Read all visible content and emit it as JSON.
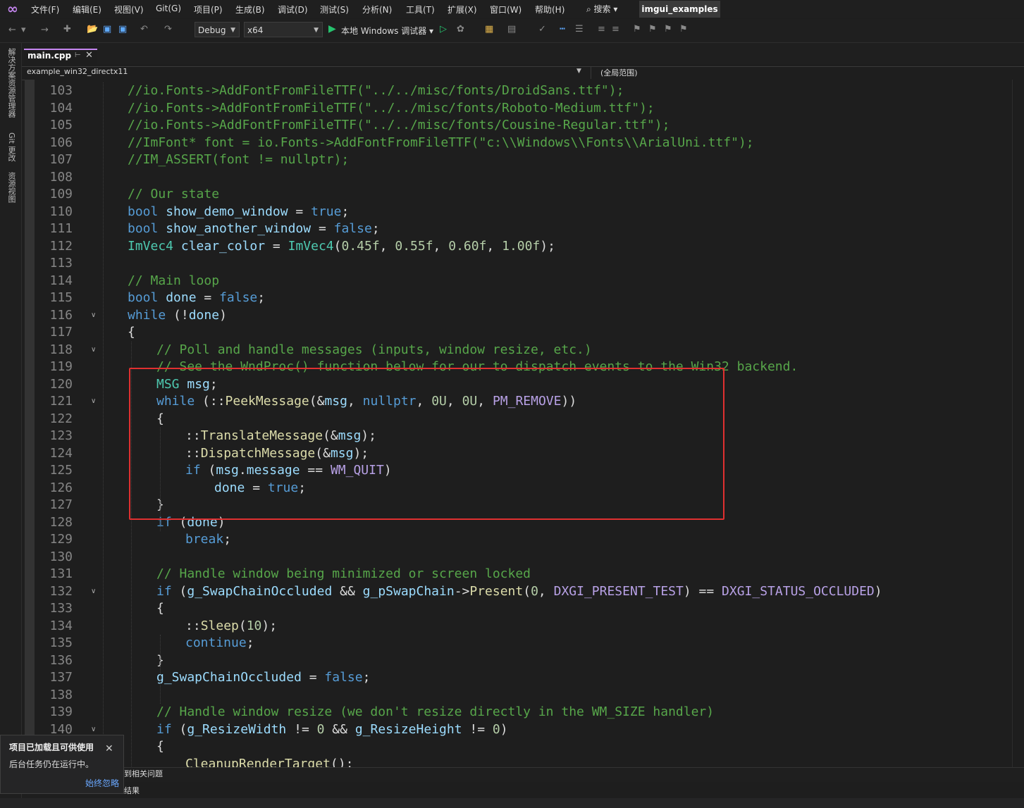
{
  "menu": {
    "items": [
      "文件(F)",
      "编辑(E)",
      "视图(V)",
      "Git(G)",
      "项目(P)",
      "生成(B)",
      "调试(D)",
      "测试(S)",
      "分析(N)",
      "工具(T)",
      "扩展(X)",
      "窗口(W)",
      "帮助(H)"
    ],
    "search": "⌕ 搜索 ▾",
    "solution_title": "imgui_examples"
  },
  "toolbar": {
    "config": "Debug",
    "platform": "x64",
    "run_label": "本地 Windows 调试器 ▾"
  },
  "sidebar": {
    "tabs": [
      "解决方案资源管理器",
      "Git 更改",
      "资源视图"
    ]
  },
  "tab": {
    "file": "main.cpp"
  },
  "nav": {
    "project": "example_win32_directx11",
    "scope": "(全局范围)"
  },
  "code": {
    "lines": [
      {
        "n": "103",
        "indent": 1,
        "html": "<span class=\"cm\">//io.Fonts-&gt;AddFontFromFileTTF(\"../../misc/fonts/DroidSans.ttf\");</span>"
      },
      {
        "n": "104",
        "indent": 1,
        "html": "<span class=\"cm\">//io.Fonts-&gt;AddFontFromFileTTF(\"../../misc/fonts/Roboto-Medium.ttf\");</span>"
      },
      {
        "n": "105",
        "indent": 1,
        "html": "<span class=\"cm\">//io.Fonts-&gt;AddFontFromFileTTF(\"../../misc/fonts/Cousine-Regular.ttf\");</span>"
      },
      {
        "n": "106",
        "indent": 1,
        "html": "<span class=\"cm\">//ImFont* font = io.Fonts-&gt;AddFontFromFileTTF(\"c:\\\\Windows\\\\Fonts\\\\ArialUni.ttf\");</span>"
      },
      {
        "n": "107",
        "indent": 1,
        "html": "<span class=\"cm\">//IM_ASSERT(font != nullptr);</span>"
      },
      {
        "n": "108",
        "indent": 1,
        "html": ""
      },
      {
        "n": "109",
        "indent": 1,
        "html": "<span class=\"cm\">// Our state</span>"
      },
      {
        "n": "110",
        "indent": 1,
        "html": "<span class=\"kw\">bool</span> <span class=\"id\">show_demo_window</span> = <span class=\"kw\">true</span>;"
      },
      {
        "n": "111",
        "indent": 1,
        "html": "<span class=\"kw\">bool</span> <span class=\"id\">show_another_window</span> = <span class=\"kw\">false</span>;"
      },
      {
        "n": "112",
        "indent": 1,
        "html": "<span class=\"ty\">ImVec4</span> <span class=\"id\">clear_color</span> = <span class=\"ty\">ImVec4</span>(<span class=\"num\">0.45f</span>, <span class=\"num\">0.55f</span>, <span class=\"num\">0.60f</span>, <span class=\"num\">1.00f</span>);"
      },
      {
        "n": "113",
        "indent": 1,
        "html": ""
      },
      {
        "n": "114",
        "indent": 1,
        "html": "<span class=\"cm\">// Main loop</span>"
      },
      {
        "n": "115",
        "indent": 1,
        "html": "<span class=\"kw\">bool</span> <span class=\"id\">done</span> = <span class=\"kw\">false</span>;"
      },
      {
        "n": "116",
        "indent": 1,
        "fold": true,
        "html": "<span class=\"kw\">while</span> (!<span class=\"id\">done</span>)"
      },
      {
        "n": "117",
        "indent": 1,
        "html": "{"
      },
      {
        "n": "118",
        "indent": 2,
        "fold": true,
        "html": "<span class=\"cm\">// Poll and handle messages (inputs, window resize, etc.)</span>"
      },
      {
        "n": "119",
        "indent": 2,
        "html": "<span class=\"cm\">// See the WndProc() function below for our to dispatch events to the Win32 backend.</span>"
      },
      {
        "n": "120",
        "indent": 2,
        "html": "<span class=\"ty\">MSG</span> <span class=\"id\">msg</span>;"
      },
      {
        "n": "121",
        "indent": 2,
        "fold": true,
        "html": "<span class=\"kw\">while</span> (::<span class=\"fn\">PeekMessage</span>(&amp;<span class=\"id\">msg</span>, <span class=\"kw\">nullptr</span>, <span class=\"num\">0U</span>, <span class=\"num\">0U</span>, <span class=\"mac\">PM_REMOVE</span>))"
      },
      {
        "n": "122",
        "indent": 2,
        "html": "{"
      },
      {
        "n": "123",
        "indent": 3,
        "html": "::<span class=\"fn\">TranslateMessage</span>(&amp;<span class=\"id\">msg</span>);"
      },
      {
        "n": "124",
        "indent": 3,
        "html": "::<span class=\"fn\">DispatchMessage</span>(&amp;<span class=\"id\">msg</span>);"
      },
      {
        "n": "125",
        "indent": 3,
        "html": "<span class=\"kw\">if</span> (<span class=\"id\">msg</span>.<span class=\"id\">message</span> == <span class=\"mac\">WM_QUIT</span>)"
      },
      {
        "n": "126",
        "indent": 4,
        "html": "<span class=\"id\">done</span> = <span class=\"kw\">true</span>;"
      },
      {
        "n": "127",
        "indent": 2,
        "html": "}"
      },
      {
        "n": "128",
        "indent": 2,
        "html": "<span class=\"kw\">if</span> (<span class=\"id\">done</span>)"
      },
      {
        "n": "129",
        "indent": 3,
        "html": "<span class=\"kw\">break</span>;"
      },
      {
        "n": "130",
        "indent": 2,
        "html": ""
      },
      {
        "n": "131",
        "indent": 2,
        "html": "<span class=\"cm\">// Handle window being minimized or screen locked</span>"
      },
      {
        "n": "132",
        "indent": 2,
        "fold": true,
        "html": "<span class=\"kw\">if</span> (<span class=\"id\">g_SwapChainOccluded</span> &amp;&amp; <span class=\"id\">g_pSwapChain</span>-&gt;<span class=\"fn\">Present</span>(<span class=\"num\">0</span>, <span class=\"mac\">DXGI_PRESENT_TEST</span>) == <span class=\"mac\">DXGI_STATUS_OCCLUDED</span>)"
      },
      {
        "n": "133",
        "indent": 2,
        "html": "{"
      },
      {
        "n": "134",
        "indent": 3,
        "html": "::<span class=\"fn\">Sleep</span>(<span class=\"num\">10</span>);"
      },
      {
        "n": "135",
        "indent": 3,
        "html": "<span class=\"kw\">continue</span>;"
      },
      {
        "n": "136",
        "indent": 2,
        "html": "}"
      },
      {
        "n": "137",
        "indent": 2,
        "html": "<span class=\"id\">g_SwapChainOccluded</span> = <span class=\"kw\">false</span>;"
      },
      {
        "n": "138",
        "indent": 2,
        "html": ""
      },
      {
        "n": "139",
        "indent": 2,
        "html": "<span class=\"cm\">// Handle window resize (we don't resize directly in the WM_SIZE handler)</span>"
      },
      {
        "n": "140",
        "indent": 2,
        "fold": true,
        "html": "<span class=\"kw\">if</span> (<span class=\"id\">g_ResizeWidth</span> != <span class=\"num\">0</span> &amp;&amp; <span class=\"id\">g_ResizeHeight</span> != <span class=\"num\">0</span>)"
      },
      {
        "n": "141",
        "indent": 2,
        "html": "{"
      },
      {
        "n": "142",
        "indent": 3,
        "html": "<span class=\"fn\">CleanupRenderTarget</span>();"
      }
    ]
  },
  "bottom": {
    "tab1": "到相关问题",
    "tab2": "结果"
  },
  "toast": {
    "title": "项目已加载且可供使用",
    "message": "后台任务仍在运行中。",
    "link": "始终忽略"
  }
}
